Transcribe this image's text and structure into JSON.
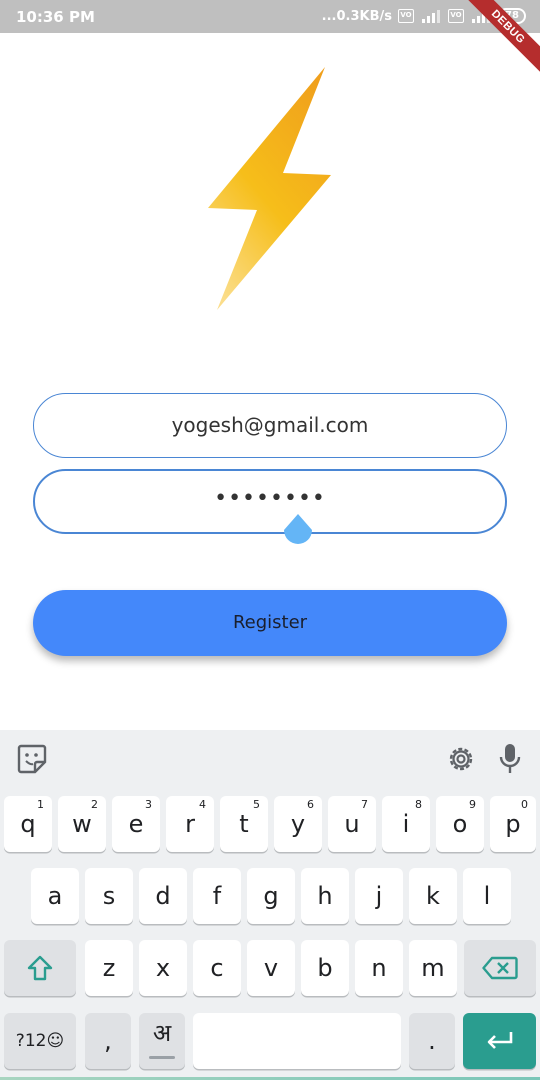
{
  "status_bar": {
    "time": "10:36 PM",
    "net_speed": "...0.3KB/s",
    "battery": "78"
  },
  "debug_label": "DEBUG",
  "form": {
    "email_value": "yogesh@gmail.com",
    "password_value": "••••••••",
    "register_label": "Register"
  },
  "keyboard": {
    "row1": [
      {
        "key": "q",
        "hint": "1"
      },
      {
        "key": "w",
        "hint": "2"
      },
      {
        "key": "e",
        "hint": "3"
      },
      {
        "key": "r",
        "hint": "4"
      },
      {
        "key": "t",
        "hint": "5"
      },
      {
        "key": "y",
        "hint": "6"
      },
      {
        "key": "u",
        "hint": "7"
      },
      {
        "key": "i",
        "hint": "8"
      },
      {
        "key": "o",
        "hint": "9"
      },
      {
        "key": "p",
        "hint": "0"
      }
    ],
    "row2": [
      "a",
      "s",
      "d",
      "f",
      "g",
      "h",
      "j",
      "k",
      "l"
    ],
    "row3": [
      "z",
      "x",
      "c",
      "v",
      "b",
      "n",
      "m"
    ],
    "symbols_key": "?12☺",
    "comma_key": ",",
    "language_key": "अ",
    "period_key": "."
  },
  "colors": {
    "accent": "#4488fa",
    "field_border": "#4a86d4",
    "enter_key": "#2a9d8f",
    "debug": "#b52d2d"
  }
}
